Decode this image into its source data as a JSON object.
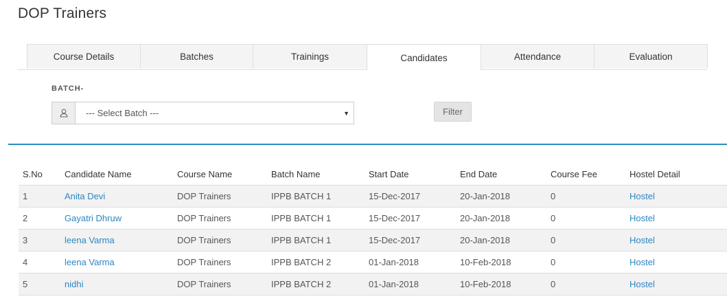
{
  "page": {
    "title": "DOP Trainers"
  },
  "tabs": [
    {
      "label": "Course Details",
      "active": false
    },
    {
      "label": "Batches",
      "active": false
    },
    {
      "label": "Trainings",
      "active": false
    },
    {
      "label": "Candidates",
      "active": true
    },
    {
      "label": "Attendance",
      "active": false
    },
    {
      "label": "Evaluation",
      "active": false
    }
  ],
  "filter": {
    "batch_label": "BATCH-",
    "batch_select_value": "--- Select Batch ---",
    "user_icon": "user-icon",
    "caret_icon": "caret-down-icon",
    "filter_button": "Filter"
  },
  "colors": {
    "link": "#2c86c4",
    "divider": "#2a8cbf",
    "stripe": "#f2f2f2"
  },
  "table": {
    "headers": [
      "S.No",
      "Candidate Name",
      "Course Name",
      "Batch Name",
      "Start Date",
      "End Date",
      "Course Fee",
      "Hostel Detail"
    ],
    "rows": [
      {
        "sno": "1",
        "name": "Anita Devi",
        "course": "DOP Trainers",
        "batch": "IPPB BATCH 1",
        "start": "15-Dec-2017",
        "end": "20-Jan-2018",
        "fee": "0",
        "hostel": "Hostel"
      },
      {
        "sno": "2",
        "name": "Gayatri Dhruw",
        "course": "DOP Trainers",
        "batch": "IPPB BATCH 1",
        "start": "15-Dec-2017",
        "end": "20-Jan-2018",
        "fee": "0",
        "hostel": "Hostel"
      },
      {
        "sno": "3",
        "name": "leena Varma",
        "course": "DOP Trainers",
        "batch": "IPPB BATCH 1",
        "start": "15-Dec-2017",
        "end": "20-Jan-2018",
        "fee": "0",
        "hostel": "Hostel"
      },
      {
        "sno": "4",
        "name": "leena Varma",
        "course": "DOP Trainers",
        "batch": "IPPB BATCH 2",
        "start": "01-Jan-2018",
        "end": "10-Feb-2018",
        "fee": "0",
        "hostel": "Hostel"
      },
      {
        "sno": "5",
        "name": "nidhi",
        "course": "DOP Trainers",
        "batch": "IPPB BATCH 2",
        "start": "01-Jan-2018",
        "end": "10-Feb-2018",
        "fee": "0",
        "hostel": "Hostel"
      }
    ]
  }
}
